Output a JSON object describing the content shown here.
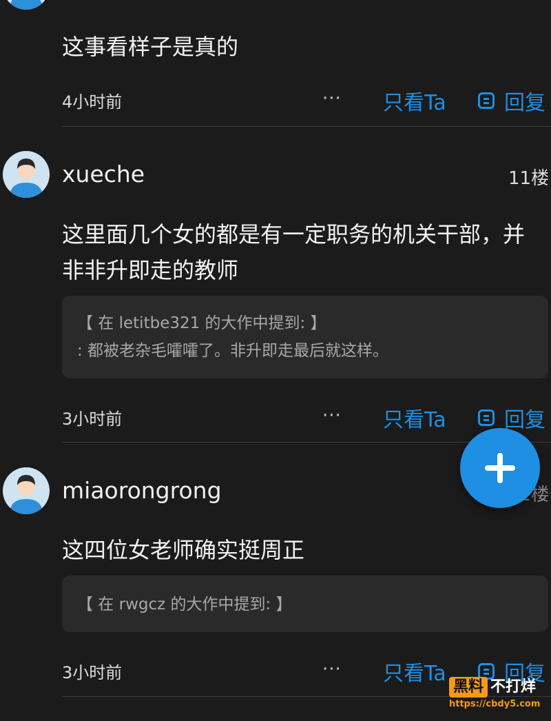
{
  "top_partial": {
    "content": "这事看样子是真的",
    "time": "4小时前",
    "more": "···",
    "only_ta": "只看Ta",
    "reply": "回复"
  },
  "posts": [
    {
      "username": "xueche",
      "floor": "11楼",
      "content_lines": [
        "这里面几个女的都是有一定职务的机关干部，并",
        "非非升即走的教师"
      ],
      "quote_lines": [
        "【 在 letitbe321 的大作中提到: 】",
        ": 都被老杂毛嚯嚯了。非升即走最后就这样。"
      ],
      "time": "3小时前",
      "more": "···",
      "only_ta": "只看Ta",
      "reply": "回复"
    },
    {
      "username": "miaorongrong",
      "floor": "12楼",
      "content_lines": [
        "这四位女老师确实挺周正"
      ],
      "quote_lines": [
        "【 在 rwgcz 的大作中提到: 】"
      ],
      "time": "3小时前",
      "more": "···",
      "only_ta": "只看Ta",
      "reply": "回复"
    }
  ],
  "watermark": {
    "brand_box": "黑料",
    "brand_text": "不打烊",
    "url": "https://cbdy5.com"
  },
  "colors": {
    "background": "#1b1b1b",
    "accent": "#1e8fe3",
    "quote_bg": "#2a2a2a",
    "watermark": "#f59a13"
  }
}
